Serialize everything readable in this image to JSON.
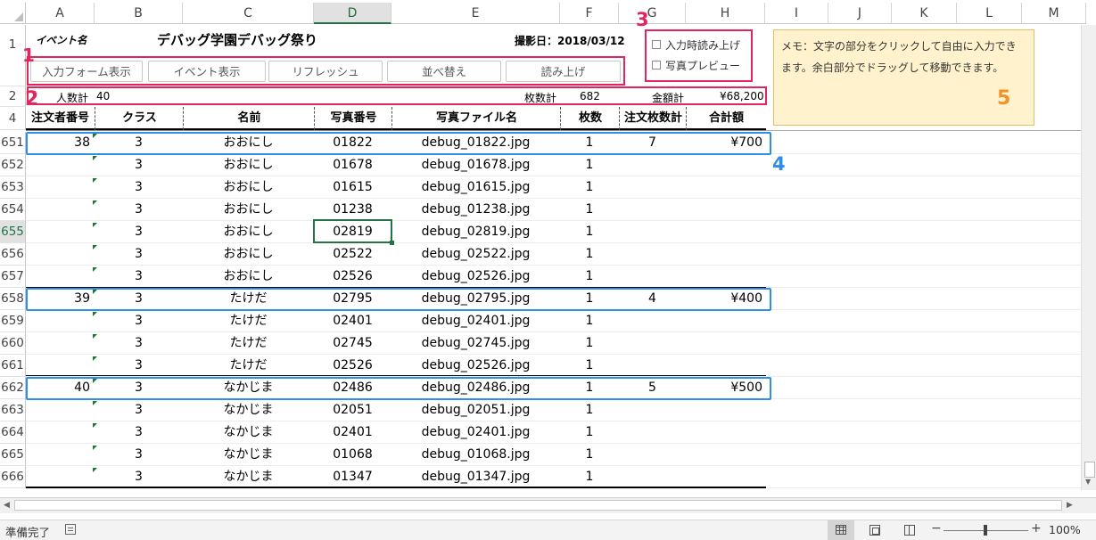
{
  "columns": [
    "A",
    "B",
    "C",
    "D",
    "E",
    "F",
    "G",
    "H",
    "I",
    "J",
    "K",
    "L",
    "M"
  ],
  "selected_column": "D",
  "selected_row": "655",
  "rows_top": [
    "1",
    "2",
    "4"
  ],
  "sheet": {
    "event_label": "イベント名",
    "event_title": "デバッグ学園デバッグ祭り",
    "shoot_date": "撮影日：2018/03/12",
    "buttons": [
      "入力フォーム表示",
      "イベント表示",
      "リフレッシュ",
      "並べ替え",
      "読み上げ"
    ],
    "checkboxes": [
      "入力時読み上げ",
      "写真プレビュー"
    ],
    "totals": {
      "people_label": "人数計",
      "people_value": "40",
      "sheets_label": "枚数計",
      "sheets_value": "682",
      "amount_label": "金額計",
      "amount_value": "¥68,200"
    },
    "memo": "メモ：文字の部分をクリックして自由に入力できます。余白部分でドラッグして移動できます。",
    "headers": [
      "注文者番号",
      "クラス",
      "名前",
      "写真番号",
      "写真ファイル名",
      "枚数",
      "注文枚数計",
      "合計額"
    ]
  },
  "data_rows": [
    {
      "row": "651",
      "order_no": "38",
      "class": "3",
      "name": "おおにし",
      "photo_no": "01822",
      "file": "debug_01822.jpg",
      "count": "1",
      "order_total": "7",
      "amount": "¥700"
    },
    {
      "row": "652",
      "order_no": "",
      "class": "3",
      "name": "おおにし",
      "photo_no": "01678",
      "file": "debug_01678.jpg",
      "count": "1",
      "order_total": "",
      "amount": ""
    },
    {
      "row": "653",
      "order_no": "",
      "class": "3",
      "name": "おおにし",
      "photo_no": "01615",
      "file": "debug_01615.jpg",
      "count": "1",
      "order_total": "",
      "amount": ""
    },
    {
      "row": "654",
      "order_no": "",
      "class": "3",
      "name": "おおにし",
      "photo_no": "01238",
      "file": "debug_01238.jpg",
      "count": "1",
      "order_total": "",
      "amount": ""
    },
    {
      "row": "655",
      "order_no": "",
      "class": "3",
      "name": "おおにし",
      "photo_no": "02819",
      "file": "debug_02819.jpg",
      "count": "1",
      "order_total": "",
      "amount": ""
    },
    {
      "row": "656",
      "order_no": "",
      "class": "3",
      "name": "おおにし",
      "photo_no": "02522",
      "file": "debug_02522.jpg",
      "count": "1",
      "order_total": "",
      "amount": ""
    },
    {
      "row": "657",
      "order_no": "",
      "class": "3",
      "name": "おおにし",
      "photo_no": "02526",
      "file": "debug_02526.jpg",
      "count": "1",
      "order_total": "",
      "amount": ""
    },
    {
      "row": "658",
      "order_no": "39",
      "class": "3",
      "name": "たけだ",
      "photo_no": "02795",
      "file": "debug_02795.jpg",
      "count": "1",
      "order_total": "4",
      "amount": "¥400"
    },
    {
      "row": "659",
      "order_no": "",
      "class": "3",
      "name": "たけだ",
      "photo_no": "02401",
      "file": "debug_02401.jpg",
      "count": "1",
      "order_total": "",
      "amount": ""
    },
    {
      "row": "660",
      "order_no": "",
      "class": "3",
      "name": "たけだ",
      "photo_no": "02745",
      "file": "debug_02745.jpg",
      "count": "1",
      "order_total": "",
      "amount": ""
    },
    {
      "row": "661",
      "order_no": "",
      "class": "3",
      "name": "たけだ",
      "photo_no": "02526",
      "file": "debug_02526.jpg",
      "count": "1",
      "order_total": "",
      "amount": ""
    },
    {
      "row": "662",
      "order_no": "40",
      "class": "3",
      "name": "なかじま",
      "photo_no": "02486",
      "file": "debug_02486.jpg",
      "count": "1",
      "order_total": "5",
      "amount": "¥500"
    },
    {
      "row": "663",
      "order_no": "",
      "class": "3",
      "name": "なかじま",
      "photo_no": "02051",
      "file": "debug_02051.jpg",
      "count": "1",
      "order_total": "",
      "amount": ""
    },
    {
      "row": "664",
      "order_no": "",
      "class": "3",
      "name": "なかじま",
      "photo_no": "02401",
      "file": "debug_02401.jpg",
      "count": "1",
      "order_total": "",
      "amount": ""
    },
    {
      "row": "665",
      "order_no": "",
      "class": "3",
      "name": "なかじま",
      "photo_no": "01068",
      "file": "debug_01068.jpg",
      "count": "1",
      "order_total": "",
      "amount": ""
    },
    {
      "row": "666",
      "order_no": "",
      "class": "3",
      "name": "なかじま",
      "photo_no": "01347",
      "file": "debug_01347.jpg",
      "count": "1",
      "order_total": "",
      "amount": ""
    }
  ],
  "annotations": [
    "1",
    "2",
    "3",
    "4",
    "5"
  ],
  "status": {
    "ready": "準備完了",
    "zoom": "100%",
    "minus": "−",
    "plus": "+"
  },
  "colors": {
    "annotation_red": "#e4245c",
    "annotation_blue": "#2f8fe7",
    "annotation_orange": "#f0932b",
    "memo_bg": "#fff2cc",
    "excel_green": "#217346"
  },
  "icons": [
    "macro-record-icon",
    "normal-view-icon",
    "page-layout-icon",
    "page-break-preview-icon",
    "scroll-left-icon",
    "scroll-right-icon"
  ]
}
